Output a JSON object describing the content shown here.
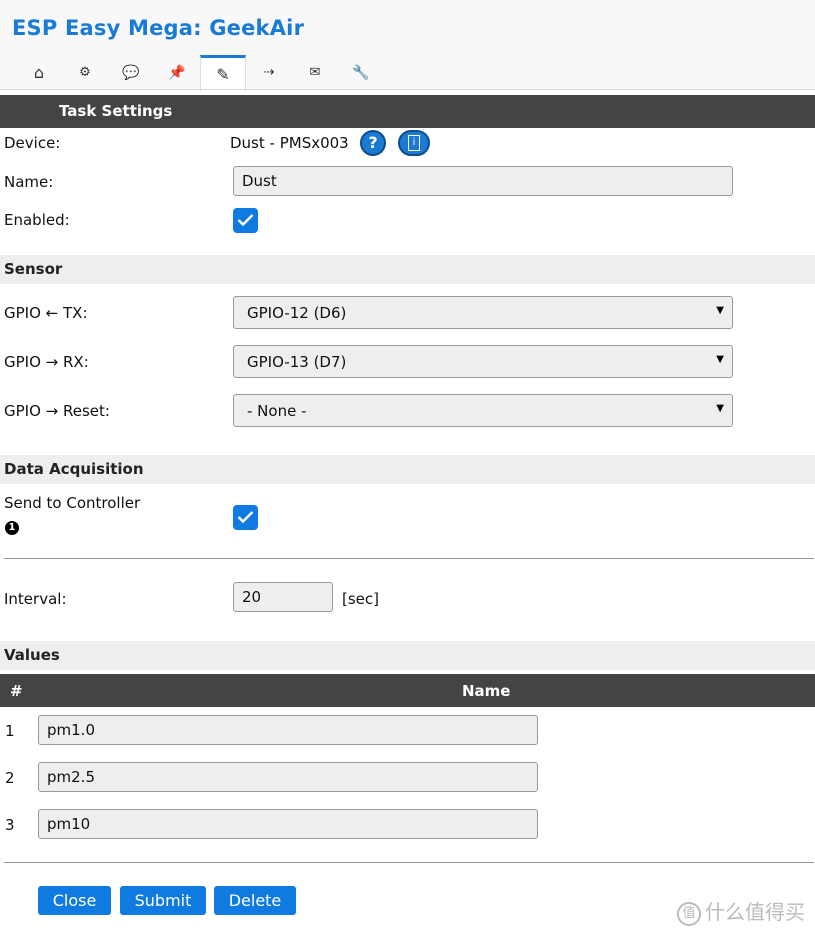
{
  "app": {
    "title": "ESP Easy Mega: GeekAir"
  },
  "tabs": [
    {
      "name": "tab-main",
      "icon": "⌂"
    },
    {
      "name": "tab-config",
      "icon": "⚙"
    },
    {
      "name": "tab-controllers",
      "icon": "💬"
    },
    {
      "name": "tab-hardware",
      "icon": "📌"
    },
    {
      "name": "tab-devices",
      "icon": "✎"
    },
    {
      "name": "tab-rules",
      "icon": "⇢"
    },
    {
      "name": "tab-notifications",
      "icon": "✉"
    },
    {
      "name": "tab-tools",
      "icon": "🔧"
    }
  ],
  "task_settings": {
    "header": "Task Settings",
    "device_label": "Device:",
    "device_value": "Dust - PMSx003",
    "help_icon": "?",
    "info_icon": "i",
    "name_label": "Name:",
    "name_value": "Dust",
    "enabled_label": "Enabled:",
    "enabled": true
  },
  "sensor": {
    "header": "Sensor",
    "gpio_tx_label": "GPIO ← TX:",
    "gpio_tx_value": "GPIO-12 (D6)",
    "gpio_rx_label": "GPIO → RX:",
    "gpio_rx_value": "GPIO-13 (D7)",
    "gpio_reset_label": "GPIO → Reset:",
    "gpio_reset_value": "- None -",
    "arrow": "▼"
  },
  "data_acquisition": {
    "header": "Data Acquisition",
    "send_label": "Send to Controller",
    "note_marker": "1",
    "send_enabled": true,
    "interval_label": "Interval:",
    "interval_value": "20",
    "interval_unit": "[sec]"
  },
  "values": {
    "header": "Values",
    "col_num": "#",
    "col_name": "Name",
    "rows": [
      {
        "num": "1",
        "name": "pm1.0"
      },
      {
        "num": "2",
        "name": "pm2.5"
      },
      {
        "num": "3",
        "name": "pm10"
      }
    ]
  },
  "buttons": {
    "close": "Close",
    "submit": "Submit",
    "delete": "Delete"
  },
  "watermark": {
    "icon": "值",
    "text": "什么值得买"
  },
  "colors": {
    "accent": "#0f7be0",
    "title": "#1a7bd6",
    "dark_bar": "#444444",
    "section_bg": "#eeeeee"
  }
}
